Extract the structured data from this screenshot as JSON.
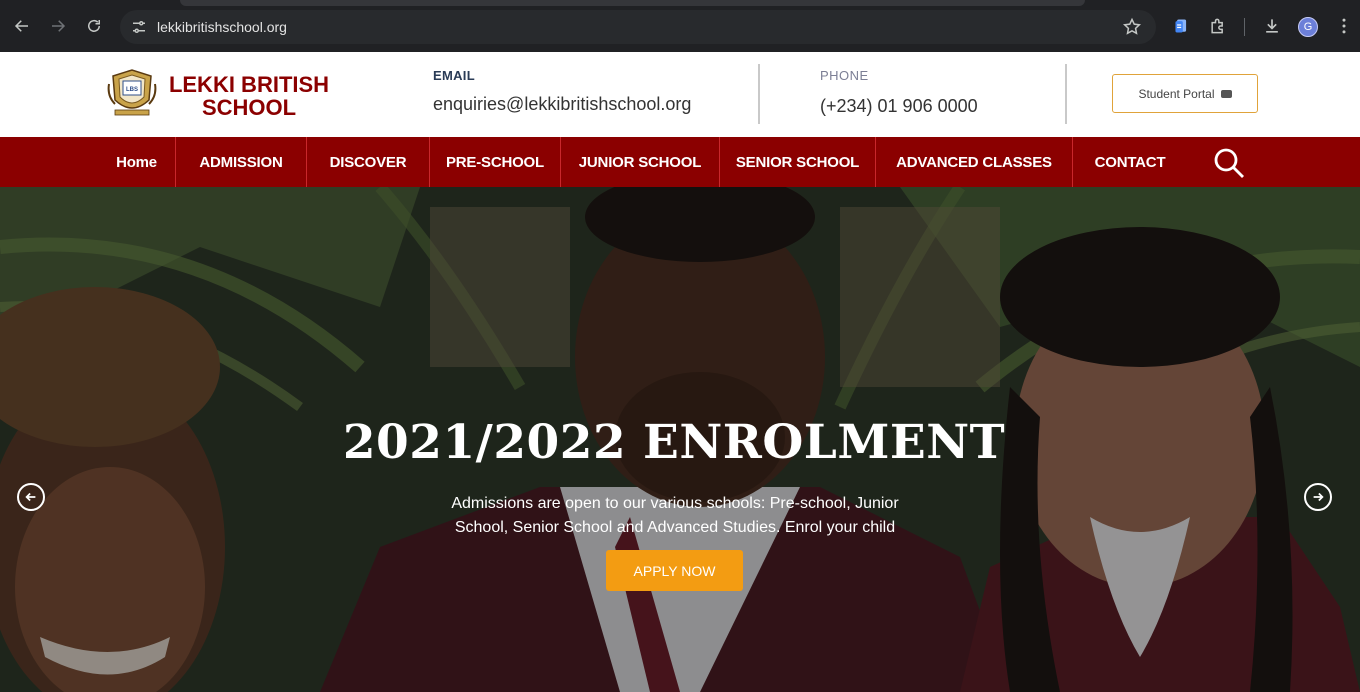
{
  "browser": {
    "url": "lekkibritishschool.org",
    "profile_initial": "G"
  },
  "header": {
    "logo_line1": "LEKKI BRITISH",
    "logo_line2": "SCHOOL",
    "logo_crest_text": "LBS",
    "email_label": "EMAIL",
    "email_value": "enquiries@lekkibritishschool.org",
    "phone_label": "PHONE",
    "phone_value": "(+234) 01 906 0000",
    "portal_label": "Student Portal"
  },
  "nav": {
    "items": [
      "Home",
      "ADMISSION",
      "DISCOVER",
      "PRE-SCHOOL",
      "JUNIOR SCHOOL",
      "SENIOR SCHOOL",
      "ADVANCED CLASSES",
      "CONTACT"
    ]
  },
  "hero": {
    "title": "2021/2022 ENROLMENT",
    "subtitle": "Admissions are open to our various schools: Pre-school, Junior School, Senior School and Advanced Studies. Enrol your child",
    "cta_label": "APPLY NOW"
  },
  "colors": {
    "brand_maroon": "#8b0000",
    "nav_separator": "#c9272b",
    "cta_orange": "#f39c12",
    "portal_border": "#e0a33a"
  },
  "icons": {
    "back": "arrow-left-icon",
    "forward": "arrow-right-icon",
    "reload": "reload-icon",
    "site_info": "tune-icon",
    "bookmark": "star-icon",
    "extension_docs": "docs-icon",
    "extensions": "puzzle-icon",
    "download": "download-icon",
    "menu": "kebab-menu-icon",
    "nav_search": "search-icon",
    "slider_prev": "circle-arrow-left-icon",
    "slider_next": "circle-arrow-right-icon"
  }
}
